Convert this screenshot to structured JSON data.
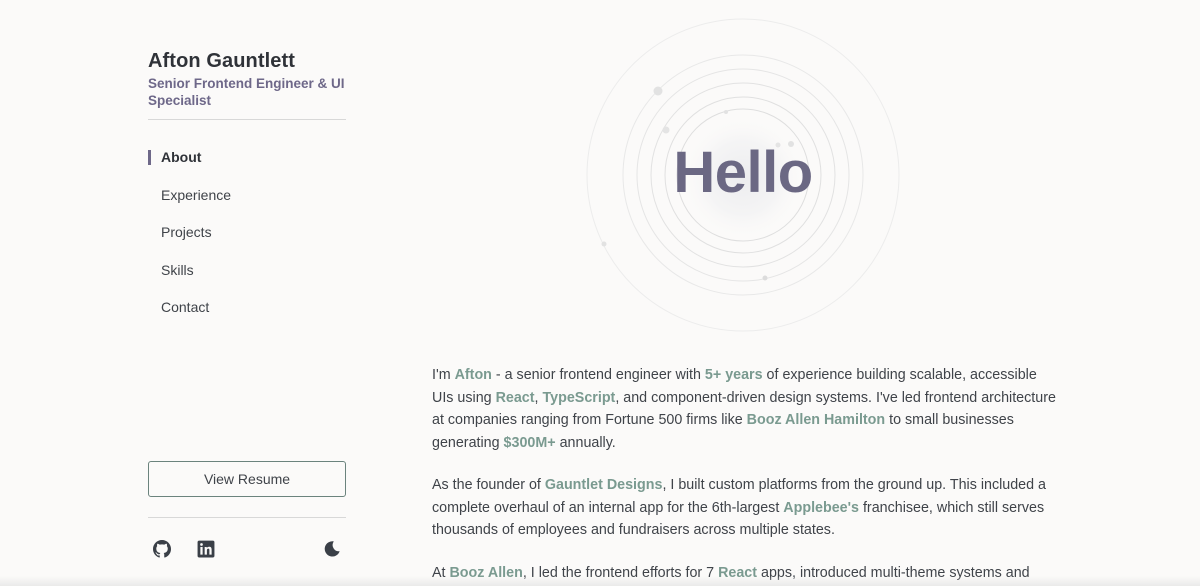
{
  "profile": {
    "name": "Afton Gauntlett",
    "role": "Senior Frontend Engineer & UI Specialist"
  },
  "nav": {
    "items": [
      {
        "label": "About",
        "active": true
      },
      {
        "label": "Experience",
        "active": false
      },
      {
        "label": "Projects",
        "active": false
      },
      {
        "label": "Skills",
        "active": false
      },
      {
        "label": "Contact",
        "active": false
      }
    ]
  },
  "sidebar": {
    "resume_label": "View Resume",
    "icons": [
      "github-icon",
      "linkedin-icon",
      "moon-icon"
    ]
  },
  "hero": {
    "greeting": "Hello"
  },
  "bio": {
    "p1": {
      "t1": "I'm ",
      "h1": "Afton",
      "t2": " - a senior frontend engineer with ",
      "h2": "5+ years",
      "t3": " of experience building scalable, accessible UIs using ",
      "h3": "React",
      "t4": ", ",
      "h4": "TypeScript",
      "t5": ", and component-driven design systems. I've led frontend architecture at companies ranging from Fortune 500 firms like ",
      "h5": "Booz Allen Hamilton",
      "t6": " to small businesses generating ",
      "h6": "$300M+",
      "t7": " annually."
    },
    "p2": {
      "t1": "As the founder of ",
      "h1": "Gauntlet Designs",
      "t2": ", I built custom platforms from the ground up. This included a complete overhaul of an internal app for the 6th-largest ",
      "h2": "Applebee's",
      "t3": " franchisee, which still serves thousands of employees and fundraisers across multiple states."
    },
    "p3": {
      "t1": "At ",
      "h1": "Booz Allen",
      "t2": ", I led the frontend efforts for 7 ",
      "h2": "React",
      "t3": " apps, introduced multi-theme systems and"
    }
  },
  "colors": {
    "background": "#fbfaf9",
    "accent_purple": "#6e6889",
    "accent_green": "#7a9a90",
    "text": "#3f4349"
  }
}
